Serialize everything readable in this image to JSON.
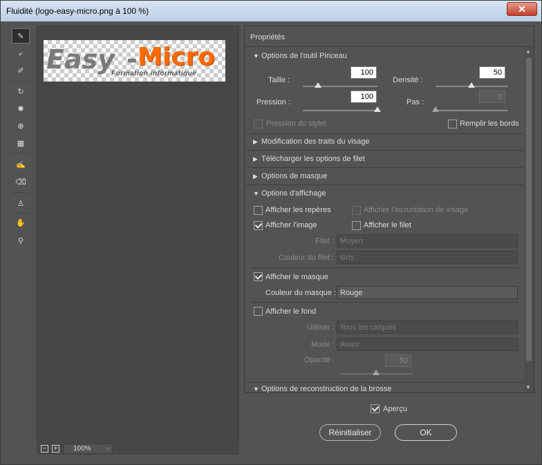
{
  "window": {
    "title": "Fluidité (logo-easy-micro.png à 100 %)",
    "close_glyph": "✕"
  },
  "tools": [
    {
      "name": "forward-warp-tool",
      "glyph": "✎",
      "active": true
    },
    {
      "name": "reconstruct-tool",
      "glyph": "⤶"
    },
    {
      "name": "smooth-tool",
      "glyph": "✐"
    },
    {
      "name": "twirl-tool",
      "glyph": "↻"
    },
    {
      "name": "pucker-tool",
      "glyph": "✺"
    },
    {
      "name": "bloat-tool",
      "glyph": "⊕"
    },
    {
      "name": "push-left-tool",
      "glyph": "▦"
    },
    {
      "name": "freeze-mask-tool",
      "glyph": "✍"
    },
    {
      "name": "thaw-mask-tool",
      "glyph": "⌫"
    },
    {
      "name": "face-tool",
      "glyph": "♙"
    },
    {
      "name": "hand-tool",
      "glyph": "✋"
    },
    {
      "name": "zoom-tool",
      "glyph": "⚲"
    }
  ],
  "preview": {
    "logo_easy": "Easy",
    "logo_dash": "-",
    "logo_micro": "Micro",
    "logo_subtitle": "Formation informatique",
    "zoom_value": "100%",
    "zoom_minus": "−",
    "zoom_plus": "+"
  },
  "props": {
    "header": "Propriétés",
    "brush_section": "Options de l'outil Pinceau",
    "taille_label": "Taille :",
    "taille_value": "100",
    "taille_level": 0.2,
    "densite_label": "Densité :",
    "densite_value": "50",
    "densite_level": 0.5,
    "pression_label": "Pression :",
    "pression_value": "100",
    "pression_level": 1.0,
    "pas_label": "Pas :",
    "pas_value": "0",
    "pas_level": 0.0,
    "stylus_pressure": "Pression du stylet",
    "pin_edges": "Remplir les bords",
    "face_section": "Modification des traits du visage",
    "load_mesh_section": "Télécharger les options de filet",
    "mask_section": "Options de masque",
    "display_section": "Options d'affichage",
    "show_guides": "Afficher les repères",
    "show_face_overlay": "Afficher l'incrustation de visage",
    "show_image": "Afficher l'image",
    "show_mesh": "Afficher le filet",
    "mesh_label": "Filet :",
    "mesh_value": "Moyen",
    "mesh_color_label": "Couleur du filet :",
    "mesh_color_value": "Gris",
    "show_mask": "Afficher le masque",
    "mask_color_label": "Couleur du masque :",
    "mask_color_value": "Rouge",
    "show_backdrop": "Afficher le fond",
    "use_label": "Utiliser :",
    "use_value": "Tous les calques",
    "mode_label": "Mode :",
    "mode_value": "Avant",
    "opacity_label": "Opacité :",
    "opacity_value": "50",
    "opacity_level": 0.5,
    "rebuild_section": "Options de reconstruction de la brosse"
  },
  "footer": {
    "preview_label": "Aperçu",
    "reset_label": "Réinitialiser",
    "ok_label": "OK"
  },
  "colors": {
    "panel": "#535353",
    "accent_orange": "#ff6a00"
  }
}
